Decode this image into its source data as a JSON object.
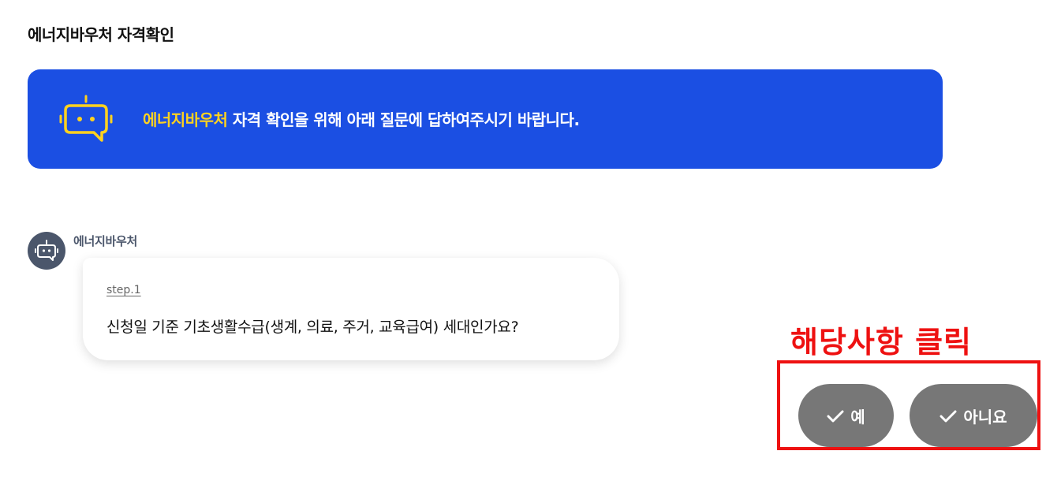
{
  "page": {
    "title": "에너지바우처 자격확인"
  },
  "banner": {
    "icon": "chatbot-icon",
    "highlight_text": "에너지바우처",
    "text": " 자격 확인을 위해 아래 질문에 답하여주시기 바랍니다.",
    "bg_color": "#1b4fe3",
    "highlight_color": "#ffd21f"
  },
  "chat": {
    "bot_name": "에너지바우처",
    "avatar_icon": "chatbot-icon",
    "step_label": "step.1",
    "question": "신청일 기준 기초생활수급(생계, 의료, 주거, 교육급여) 세대인가요?"
  },
  "annotation": {
    "text": "해당사항 클릭",
    "color": "#ee1111"
  },
  "answers": {
    "yes_label": "예",
    "no_label": "아니요",
    "icon": "check-icon",
    "bg_color": "#777777"
  }
}
